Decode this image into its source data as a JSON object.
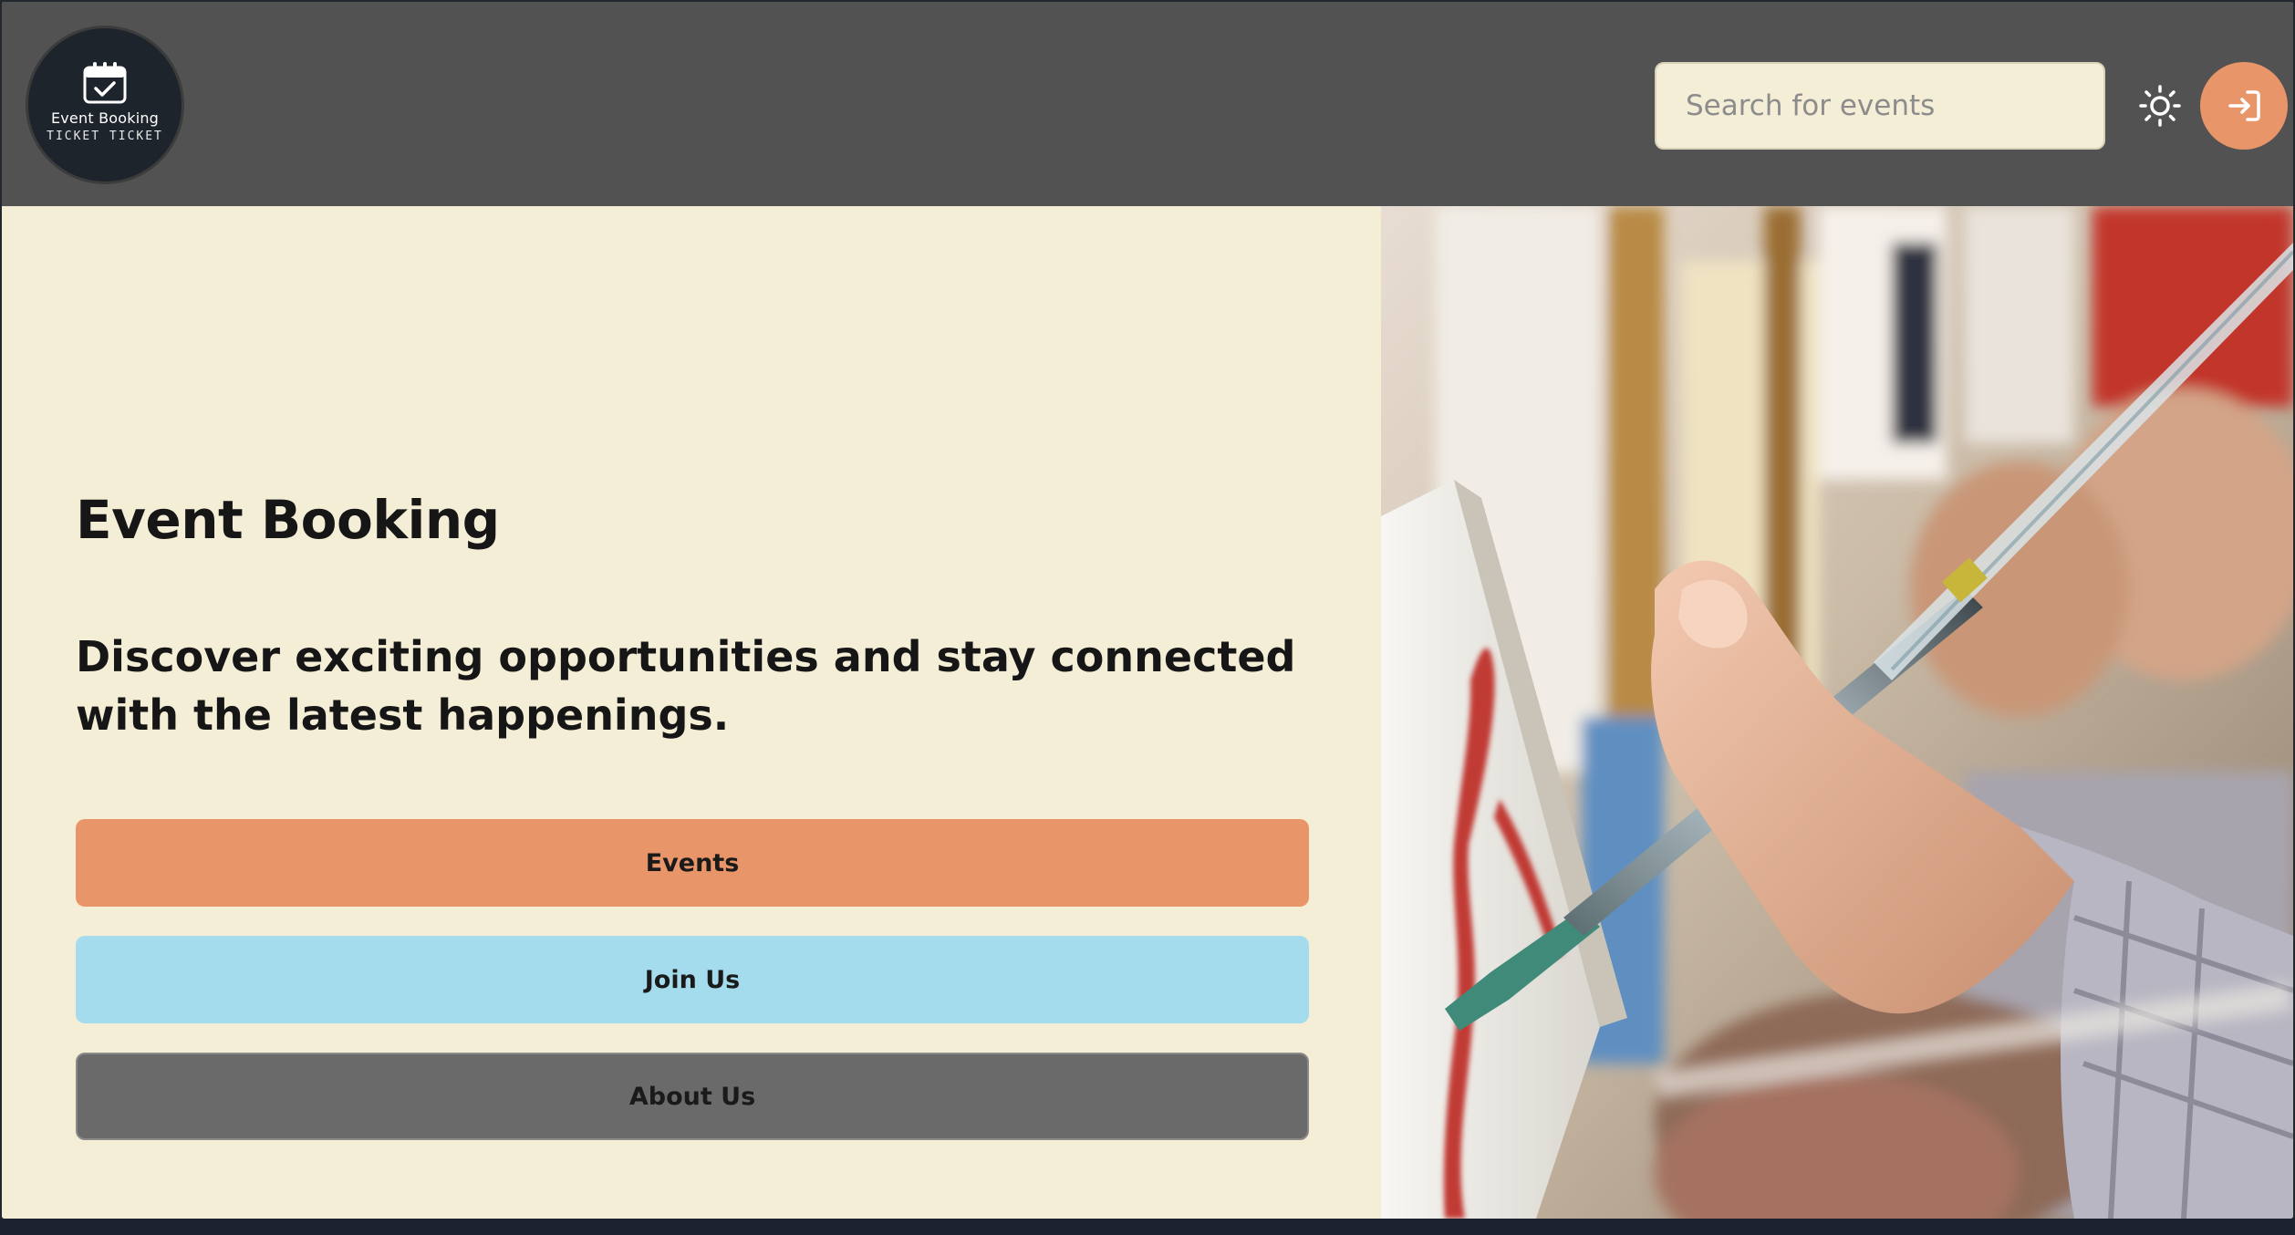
{
  "header": {
    "logo": {
      "name": "Event Booking",
      "subtitle": "TICKET TICKET",
      "icon": "calendar-check-icon"
    },
    "search": {
      "placeholder": "Search for events",
      "value": ""
    },
    "theme_toggle_icon": "sun-icon",
    "login_icon": "login-arrow-icon"
  },
  "hero": {
    "title": "Event Booking",
    "tagline": "Discover exciting opportunities and stay connected with the latest happenings.",
    "buttons": {
      "events": "Events",
      "join": "Join Us",
      "about": "About Us"
    },
    "image_subject": "painting-class-photo"
  },
  "colors": {
    "header_bg": "#525252",
    "page_bg": "#f4eed7",
    "accent_orange": "#e9956a",
    "accent_blue": "#a5dced",
    "button_gray": "#6a6a6a",
    "logo_bg": "#1d242c"
  }
}
